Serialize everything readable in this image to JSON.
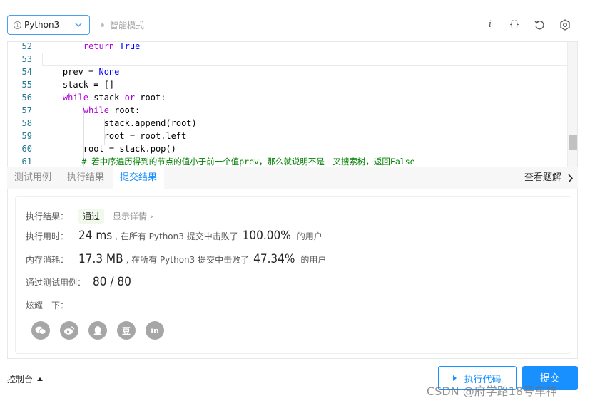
{
  "toolbar": {
    "language": "Python3",
    "info_glyph": "i",
    "smart_mode": "智能模式",
    "icons": [
      "info-icon",
      "braces-icon",
      "reset-icon",
      "settings-icon"
    ],
    "italic_i": "i",
    "braces": "{}"
  },
  "editor": {
    "lines": [
      {
        "num": "52",
        "code": "        return True"
      },
      {
        "num": "53",
        "code": ""
      },
      {
        "num": "54",
        "code": "    prev = None"
      },
      {
        "num": "55",
        "code": "    stack = []"
      },
      {
        "num": "56",
        "code": "    while stack or root:"
      },
      {
        "num": "57",
        "code": "        while root:"
      },
      {
        "num": "58",
        "code": "            stack.append(root)"
      },
      {
        "num": "59",
        "code": "            root = root.left"
      },
      {
        "num": "60",
        "code": "        root = stack.pop()"
      },
      {
        "num": "61",
        "code": "        # 若中序遍历得到的节点的值小于前一个值prev，那么就说明不是二叉搜索树，返回False"
      }
    ]
  },
  "tabs": {
    "items": [
      "测试用例",
      "执行结果",
      "提交结果"
    ],
    "active": "提交结果",
    "view_solution": "查看题解"
  },
  "result": {
    "status_label": "执行结果：",
    "status": "通过",
    "show_detail": "显示详情",
    "show_detail_chevron": "›",
    "time_label": "执行用时：",
    "time_value": "24 ms",
    "time_desc": ", 在所有 Python3 提交中击败了",
    "time_percent": "100.00%",
    "users": "的用户",
    "memory_label": "内存消耗：",
    "memory_value": "17.3 MB",
    "memory_desc": ", 在所有 Python3 提交中击败了",
    "memory_percent": "47.34%",
    "tests_label": "通过测试用例：",
    "tests_value": "80 / 80",
    "share_label": "炫耀一下：",
    "share_icons": [
      "wechat-icon",
      "weibo-icon",
      "qq-icon",
      "douban-icon",
      "linkedin-icon"
    ],
    "share_glyphs": {
      "douban": "豆",
      "linkedin": "in"
    }
  },
  "footer": {
    "console": "控制台",
    "run": "执行代码",
    "submit": "提交"
  },
  "watermark": "CSDN @府学路18号车神",
  "colors": {
    "accent": "#1890ff",
    "pass_bg": "#f0f9eb",
    "icon_gray": "#a6a6a6"
  }
}
